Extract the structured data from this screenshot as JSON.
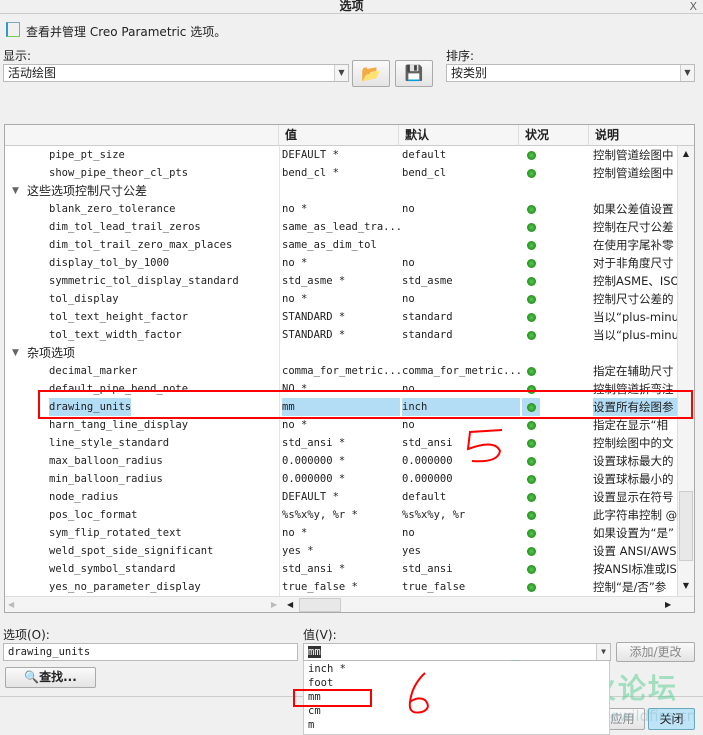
{
  "window": {
    "title": "选项",
    "close": "X"
  },
  "intro": "查看并管理 Creo Parametric 选项。",
  "display": {
    "label": "显示:",
    "value": "活动绘图"
  },
  "sort": {
    "label": "排序:",
    "value": "按类别"
  },
  "columns": [
    "值",
    "默认",
    "状况",
    "说明"
  ],
  "rows": [
    {
      "type": "item",
      "name": "pipe_pt_size",
      "value": "DEFAULT *",
      "default": "default",
      "desc": "控制管道绘图中"
    },
    {
      "type": "item",
      "name": "show_pipe_theor_cl_pts",
      "value": "bend_cl *",
      "default": "bend_cl",
      "desc": "控制管道绘图中"
    },
    {
      "type": "group",
      "name": "这些选项控制尺寸公差"
    },
    {
      "type": "item",
      "name": "blank_zero_tolerance",
      "value": "no *",
      "default": "no",
      "desc": "如果公差值设置"
    },
    {
      "type": "item",
      "name": "dim_tol_lead_trail_zeros",
      "value": "same_as_lead_tra...",
      "default": "",
      "desc": "控制在尺寸公差"
    },
    {
      "type": "item",
      "name": "dim_tol_trail_zero_max_places",
      "value": "same_as_dim_tol",
      "default": "",
      "desc": "在使用字尾补零"
    },
    {
      "type": "item",
      "name": "display_tol_by_1000",
      "value": "no *",
      "default": "no",
      "desc": "对于非角度尺寸"
    },
    {
      "type": "item",
      "name": "symmetric_tol_display_standard",
      "value": "std_asme *",
      "default": "std_asme",
      "desc": "控制ASME、ISO及"
    },
    {
      "type": "item",
      "name": "tol_display",
      "value": "no *",
      "default": "no",
      "desc": "控制尺寸公差的"
    },
    {
      "type": "item",
      "name": "tol_text_height_factor",
      "value": "STANDARD *",
      "default": "standard",
      "desc": "当以“plus-minu"
    },
    {
      "type": "item",
      "name": "tol_text_width_factor",
      "value": "STANDARD *",
      "default": "standard",
      "desc": "当以“plus-minu"
    },
    {
      "type": "group",
      "name": "杂项选项"
    },
    {
      "type": "item",
      "name": "decimal_marker",
      "value": "comma_for_metric...",
      "default": "comma_for_metric...",
      "desc": "指定在辅助尺寸"
    },
    {
      "type": "item",
      "name": "default_pipe_bend_note",
      "value": "NO *",
      "default": "no",
      "desc": "控制管道折弯注"
    },
    {
      "type": "item",
      "name": "drawing_units",
      "value": "mm",
      "default": "inch",
      "desc": "设置所有绘图参",
      "selected": true
    },
    {
      "type": "item",
      "name": "harn_tang_line_display",
      "value": "no *",
      "default": "no",
      "desc": "指定在显示“相"
    },
    {
      "type": "item",
      "name": "line_style_standard",
      "value": "std_ansi *",
      "default": "std_ansi",
      "desc": "控制绘图中的文"
    },
    {
      "type": "item",
      "name": "max_balloon_radius",
      "value": "0.000000 *",
      "default": "0.000000",
      "desc": "设置球标最大的"
    },
    {
      "type": "item",
      "name": "min_balloon_radius",
      "value": "0.000000 *",
      "default": "0.000000",
      "desc": "设置球标最小的"
    },
    {
      "type": "item",
      "name": "node_radius",
      "value": "DEFAULT *",
      "default": "default",
      "desc": "设置显示在符号"
    },
    {
      "type": "item",
      "name": "pos_loc_format",
      "value": "%s%x%y, %r *",
      "default": "%s%x%y, %r",
      "desc": "此字符串控制 @"
    },
    {
      "type": "item",
      "name": "sym_flip_rotated_text",
      "value": "no *",
      "default": "no",
      "desc": "如果设置为“是”"
    },
    {
      "type": "item",
      "name": "weld_spot_side_significant",
      "value": "yes *",
      "default": "yes",
      "desc": "设置 ANSI/AWS2"
    },
    {
      "type": "item",
      "name": "weld_symbol_standard",
      "value": "std_ansi *",
      "default": "std_ansi",
      "desc": "按ANSI标准或IS"
    },
    {
      "type": "item",
      "name": "yes_no_parameter_display",
      "value": "true_false *",
      "default": "true_false",
      "desc": "控制“是/否”参"
    }
  ],
  "option": {
    "label": "选项(O):",
    "value": "drawing_units"
  },
  "valuefield": {
    "label": "值(V):",
    "value": "mm",
    "options": [
      "inch *",
      "foot",
      "mm",
      "cm",
      "m"
    ]
  },
  "buttons": {
    "add": "添加/更改",
    "find": "查找...",
    "apply": "应用",
    "close": "关闭"
  },
  "annotations": {
    "step5": "5",
    "step6": "6"
  },
  "watermark": {
    "text": "野火论坛",
    "url": "www.proewildfire.cn"
  },
  "colors": {
    "status": "#2a9a2a",
    "selection": "#b3dcf5",
    "annotation": "#ff0000"
  }
}
